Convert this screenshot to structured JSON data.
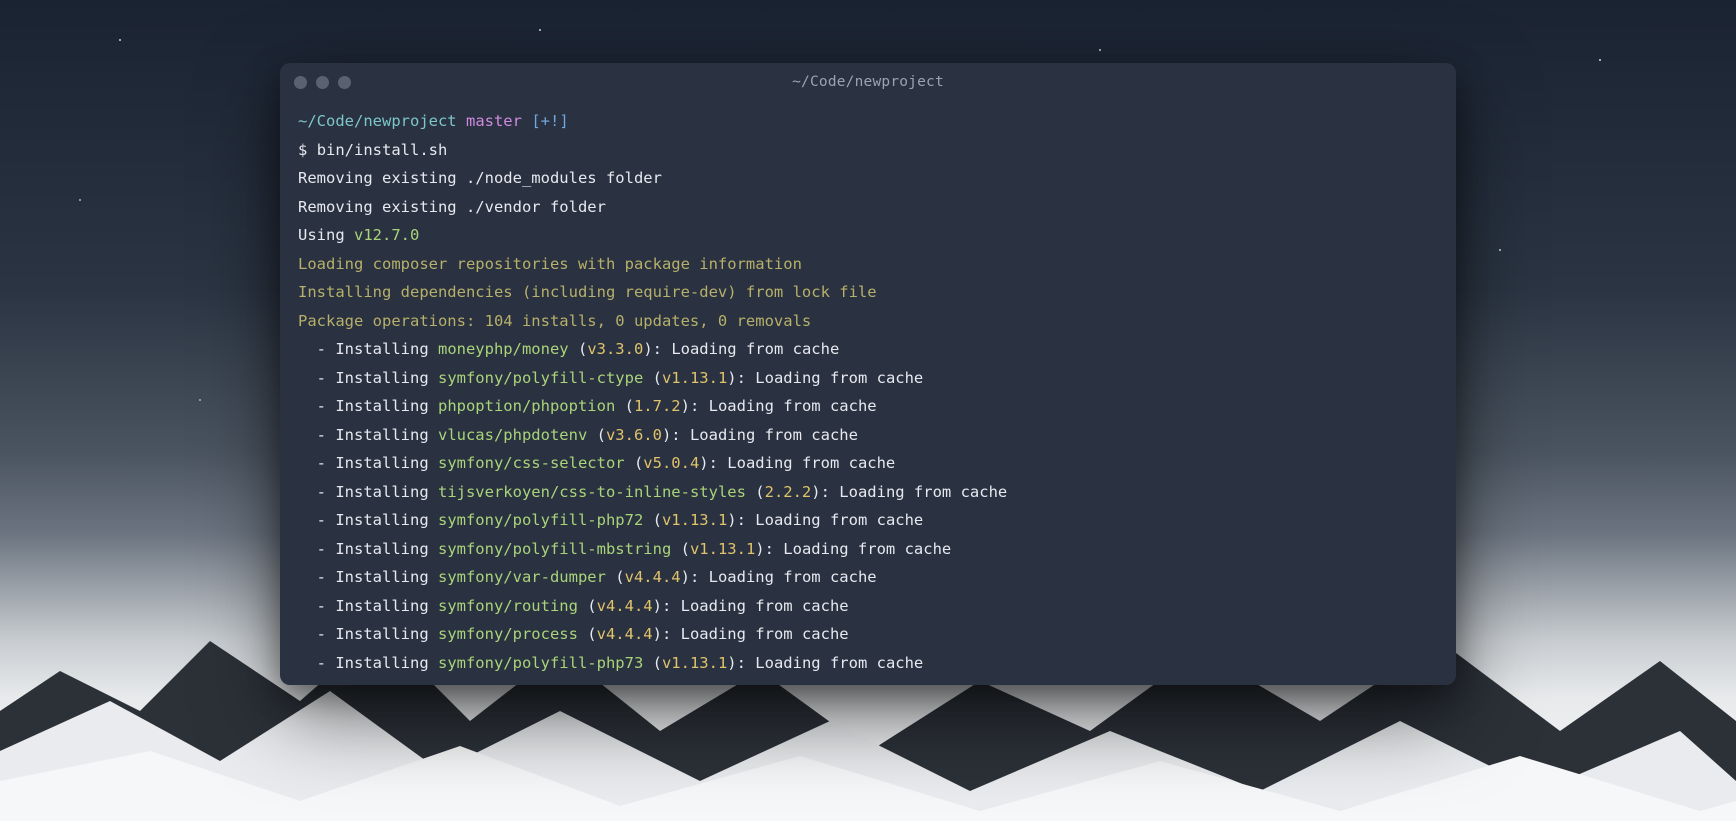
{
  "window": {
    "title": "~/Code/newproject"
  },
  "prompt": {
    "path": "~/Code/newproject",
    "branch": "master",
    "flags": "[+!]",
    "symbol": "$",
    "command": "bin/install.sh"
  },
  "lines": {
    "rm_node": "Removing existing ./node_modules folder",
    "rm_vendor": "Removing existing ./vendor folder",
    "using": "Using ",
    "using_ver": "v12.7.0",
    "composer_loading": "Loading composer repositories with package information",
    "composer_install": "Installing dependencies (including require-dev) from lock file",
    "pkg_ops": "Package operations: 104 installs, 0 updates, 0 removals"
  },
  "install": {
    "prefix": "  - Installing ",
    "open": " (",
    "close": "): ",
    "status": "Loading from cache",
    "items": [
      {
        "pkg": "moneyphp/money",
        "ver": "v3.3.0"
      },
      {
        "pkg": "symfony/polyfill-ctype",
        "ver": "v1.13.1"
      },
      {
        "pkg": "phpoption/phpoption",
        "ver": "1.7.2"
      },
      {
        "pkg": "vlucas/phpdotenv",
        "ver": "v3.6.0"
      },
      {
        "pkg": "symfony/css-selector",
        "ver": "v5.0.4"
      },
      {
        "pkg": "tijsverkoyen/css-to-inline-styles",
        "ver": "2.2.2"
      },
      {
        "pkg": "symfony/polyfill-php72",
        "ver": "v1.13.1"
      },
      {
        "pkg": "symfony/polyfill-mbstring",
        "ver": "v1.13.1"
      },
      {
        "pkg": "symfony/var-dumper",
        "ver": "v4.4.4"
      },
      {
        "pkg": "symfony/routing",
        "ver": "v4.4.4"
      },
      {
        "pkg": "symfony/process",
        "ver": "v4.4.4"
      },
      {
        "pkg": "symfony/polyfill-php73",
        "ver": "v1.13.1"
      }
    ]
  }
}
